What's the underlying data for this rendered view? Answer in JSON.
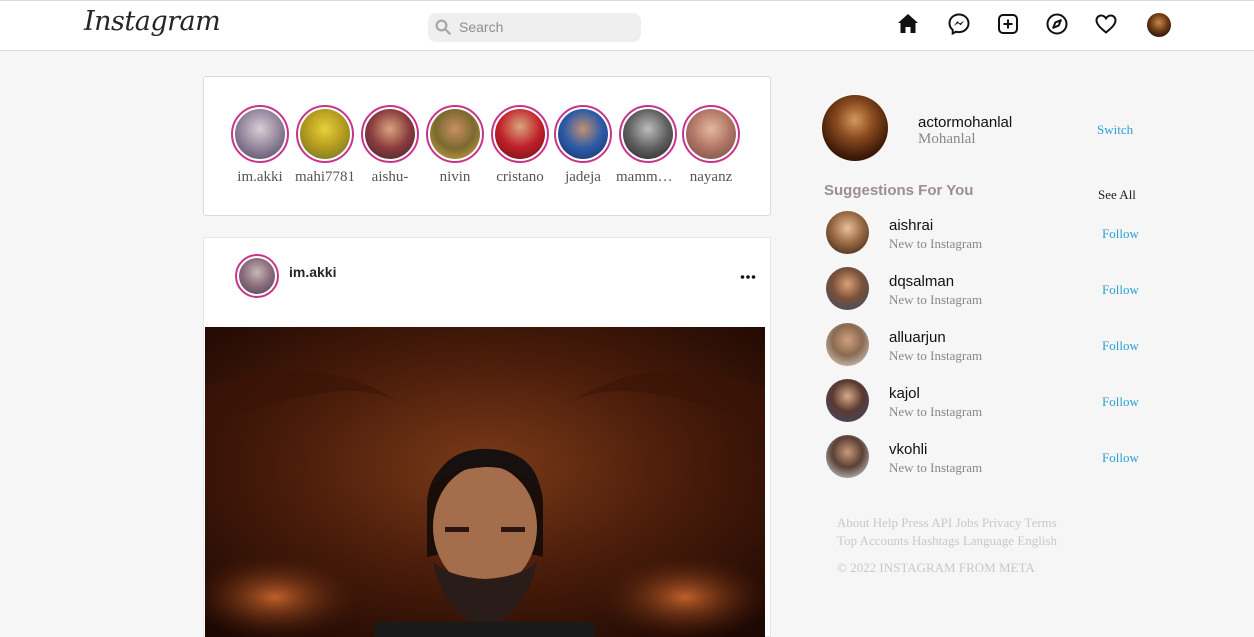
{
  "header": {
    "logo": "Instagram",
    "search_placeholder": "Search"
  },
  "stories": [
    {
      "name": "im.akki"
    },
    {
      "name": "mahi7781"
    },
    {
      "name": "aishu-"
    },
    {
      "name": "nivin"
    },
    {
      "name": "cristano"
    },
    {
      "name": "jadeja"
    },
    {
      "name": "mammootty"
    },
    {
      "name": "nayanz"
    }
  ],
  "post": {
    "username": "im.akki"
  },
  "profile": {
    "username": "actormohanlal",
    "name": "Mohanlal",
    "switch_label": "Switch"
  },
  "suggestions": {
    "title": "Suggestions For You",
    "see_all": "See All",
    "items": [
      {
        "username": "aishrai",
        "subtitle": "New to Instagram",
        "action": "Follow"
      },
      {
        "username": "dqsalman",
        "subtitle": "New to Instagram",
        "action": "Follow"
      },
      {
        "username": "alluarjun",
        "subtitle": "New to Instagram",
        "action": "Follow"
      },
      {
        "username": "kajol",
        "subtitle": "New to Instagram",
        "action": "Follow"
      },
      {
        "username": "vkohli",
        "subtitle": "New to Instagram",
        "action": "Follow"
      }
    ]
  },
  "footer": {
    "links_line1": "About Help Press API Jobs Privacy Terms",
    "links_line2": "Top Accounts Hashtags Language English",
    "copyright": "© 2022 INSTAGRAM FROM META"
  },
  "colors": {
    "story_ring": "#c8348a",
    "link_blue": "#2a9fd8",
    "suggestion_title": "#9c8e96"
  }
}
